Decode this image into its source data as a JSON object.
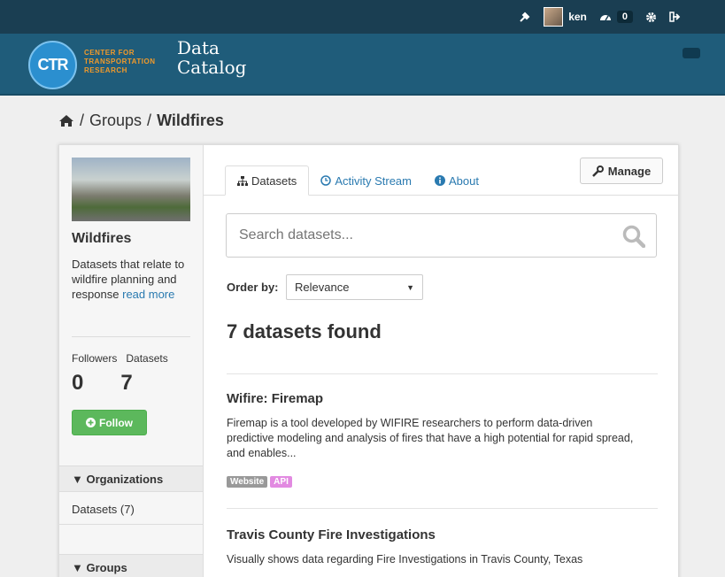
{
  "account": {
    "user_name": "ken",
    "activity_count": "0"
  },
  "site": {
    "logo_abbr": "CTR",
    "org_name_lines": [
      "CENTER FOR",
      "TRANSPORTATION",
      "RESEARCH"
    ],
    "title_line1": "Data",
    "title_line2": "Catalog"
  },
  "breadcrumb": {
    "items": [
      "/",
      "Groups",
      "/"
    ],
    "current": "Wildfires"
  },
  "group": {
    "title": "Wildfires",
    "description": "Datasets that relate to wildfire planning and response",
    "read_more": "read more",
    "followers_label": "Followers",
    "datasets_label": "Datasets",
    "followers_count": "0",
    "datasets_count": "7",
    "follow_label": "Follow"
  },
  "facets": {
    "organizations_label": "Organizations",
    "organizations_item": "Datasets (7)",
    "groups_label": "Groups"
  },
  "tabs": {
    "datasets": "Datasets",
    "activity": "Activity Stream",
    "about": "About",
    "manage": "Manage"
  },
  "search": {
    "placeholder": "Search datasets..."
  },
  "order": {
    "label": "Order by:",
    "selected": "Relevance"
  },
  "results": {
    "found_text": "7 datasets found",
    "datasets": [
      {
        "title": "Wifire: Firemap",
        "description": "Firemap is a tool developed by WIFIRE researchers to perform data-driven predictive modeling and analysis of fires that have a high potential for rapid spread, and enables...",
        "tags": [
          "Website",
          "API"
        ]
      },
      {
        "title": "Travis County Fire Investigations",
        "description": "Visually shows data regarding Fire Investigations in Travis County, Texas"
      }
    ]
  },
  "colors": {
    "account_bar": "#1a3e52",
    "masthead": "#1f5c7a",
    "follow_green": "#5cb85c",
    "link_blue": "#2a7ab0",
    "tag_api": "#e28ae1"
  }
}
